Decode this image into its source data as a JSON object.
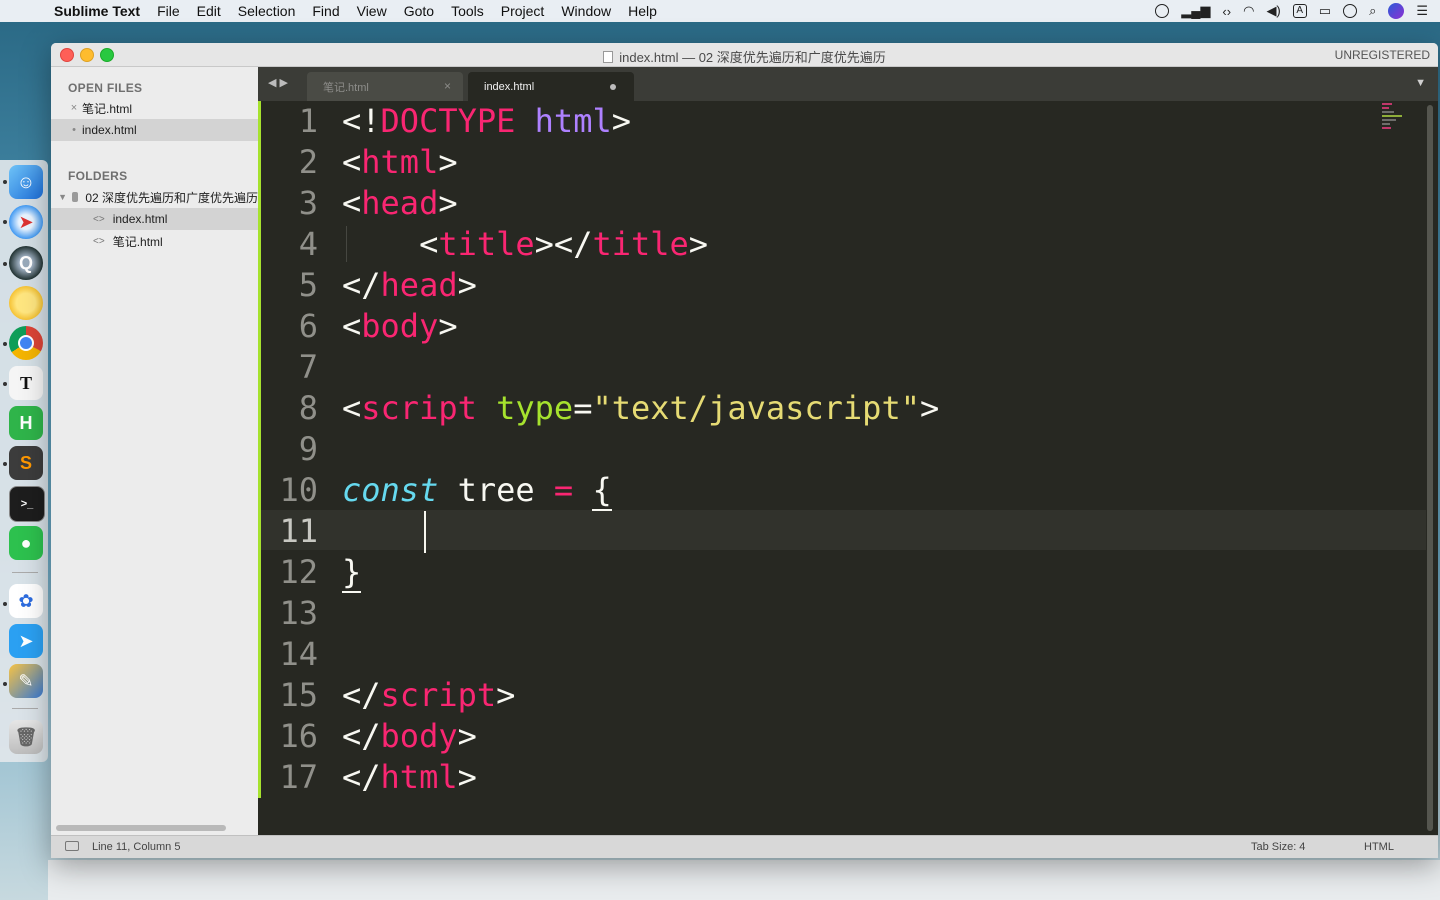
{
  "menubar": {
    "app_name": "Sublime Text",
    "items": [
      "File",
      "Edit",
      "Selection",
      "Find",
      "View",
      "Goto",
      "Tools",
      "Project",
      "Window",
      "Help"
    ],
    "input_badge": "A"
  },
  "window": {
    "title": "index.html — 02 深度优先遍历和广度优先遍历",
    "unregistered": "UNREGISTERED"
  },
  "sidebar": {
    "open_files_heading": "OPEN FILES",
    "open_files": [
      {
        "name": "笔记.html",
        "marker": "×"
      },
      {
        "name": "index.html",
        "marker": "•",
        "selected": true
      }
    ],
    "folders_heading": "FOLDERS",
    "folder_name": "02 深度优先遍历和广度优先遍历",
    "folder_files": [
      {
        "name": "index.html",
        "selected": true
      },
      {
        "name": "笔记.html"
      }
    ],
    "file_icon_glyph": "<>"
  },
  "tabs": [
    {
      "label": "笔记.html",
      "active": false,
      "close_glyph": "×"
    },
    {
      "label": "index.html",
      "active": true,
      "dirty": true
    }
  ],
  "editor": {
    "line_numbers": [
      "1",
      "2",
      "3",
      "4",
      "5",
      "6",
      "7",
      "8",
      "9",
      "10",
      "11",
      "12",
      "13",
      "14",
      "15",
      "16",
      "17"
    ],
    "current_line": 11,
    "colors": {
      "background": "#272822",
      "tag": "#f92672",
      "keyword": "#66d9ef",
      "attribute": "#a6e22e",
      "string": "#e6db74",
      "constant": "#ae81ff",
      "gutter_marker": "#a6e22e"
    }
  },
  "status": {
    "position": "Line 11, Column 5",
    "tab_size": "Tab Size: 4",
    "syntax": "HTML"
  }
}
